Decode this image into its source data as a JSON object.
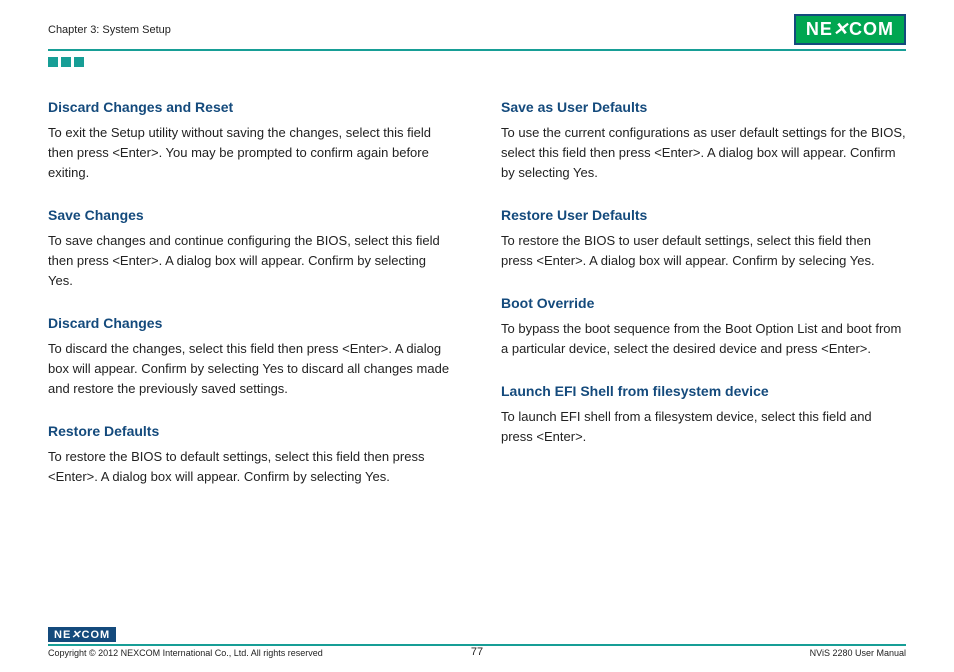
{
  "header": {
    "chapter": "Chapter 3: System Setup",
    "logo": "NE COM"
  },
  "left": {
    "s1": {
      "title": "Discard Changes and Reset",
      "body": "To exit the Setup utility without saving the changes, select this field then press <Enter>. You may be prompted to confirm again before exiting."
    },
    "s2": {
      "title": "Save Changes",
      "body": "To save changes and continue configuring the BIOS, select this field then press <Enter>. A dialog box will appear. Confirm by selecting Yes."
    },
    "s3": {
      "title": "Discard Changes",
      "body": "To discard the changes, select this field then press <Enter>. A dialog box will appear. Confirm by selecting Yes to discard all changes made and restore the previously saved settings."
    },
    "s4": {
      "title": "Restore Defaults",
      "body": "To restore the BIOS to default settings, select this field then press <Enter>. A dialog box will appear. Confirm by selecting Yes."
    }
  },
  "right": {
    "s1": {
      "title": "Save as User Defaults",
      "body": "To use the current configurations as user default settings for the BIOS, select this field then press <Enter>. A dialog box will appear. Confirm by selecting Yes."
    },
    "s2": {
      "title": "Restore User Defaults",
      "body": "To restore the BIOS to user default settings, select this field then press <Enter>. A dialog box will appear. Confirm by selecing Yes."
    },
    "s3": {
      "title": "Boot Override",
      "body": "To bypass the boot sequence from the Boot Option List and boot from a particular device, select the desired device and press <Enter>."
    },
    "s4": {
      "title": "Launch EFI Shell from filesystem device",
      "body": "To launch EFI shell from a filesystem device, select this field and press <Enter>."
    }
  },
  "footer": {
    "logo": "NE COM",
    "copyright": "Copyright © 2012 NEXCOM International Co., Ltd. All rights reserved",
    "page": "77",
    "manual": "NViS 2280 User Manual"
  }
}
